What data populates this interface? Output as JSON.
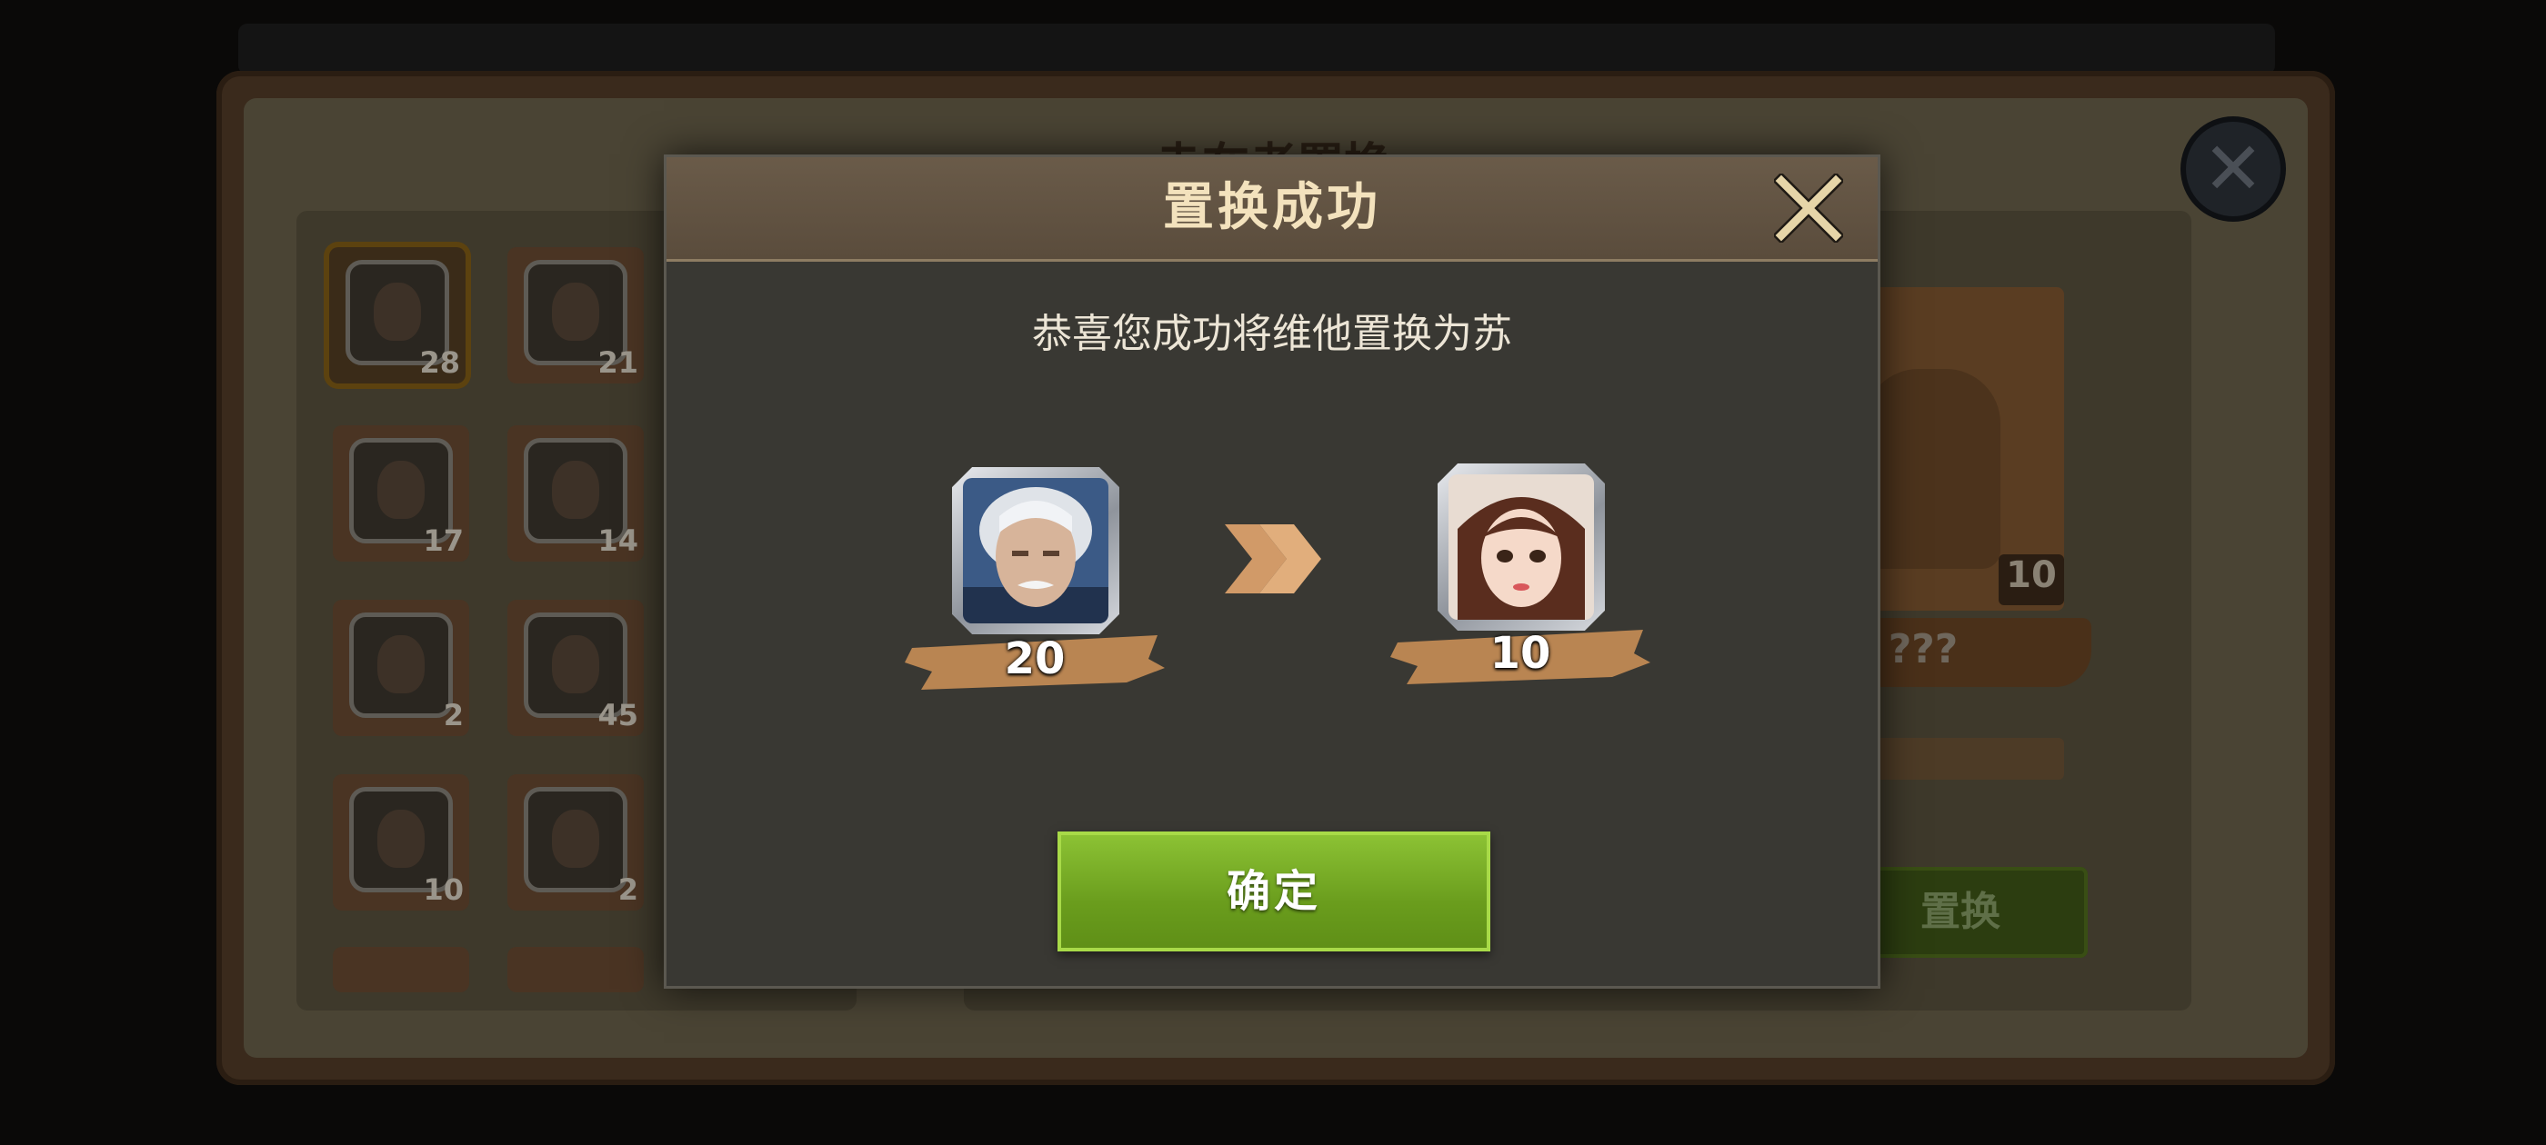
{
  "background": {
    "title": "赤在者置换",
    "hero_list": [
      {
        "count": "28",
        "selected": true
      },
      {
        "count": "21"
      },
      {
        "count": "17"
      },
      {
        "count": "14"
      },
      {
        "count": "2"
      },
      {
        "count": "45"
      },
      {
        "count": "10"
      },
      {
        "count": "2"
      }
    ],
    "target_card": {
      "count": "10",
      "name": "???"
    },
    "action_button_label": "置换"
  },
  "modal": {
    "title": "置换成功",
    "message": "恭喜您成功将维他置换为苏",
    "from_hero": {
      "count": "20",
      "portrait": "old-man-portrait"
    },
    "to_hero": {
      "count": "10",
      "portrait": "young-woman-portrait"
    },
    "arrow_icon": "double-chevron-right-icon",
    "close_icon": "close-icon",
    "confirm_label": "确定"
  },
  "colors": {
    "modal_title": "#f3e2bd",
    "confirm_green": "#7bb22a",
    "ribbon": "#b98552"
  }
}
